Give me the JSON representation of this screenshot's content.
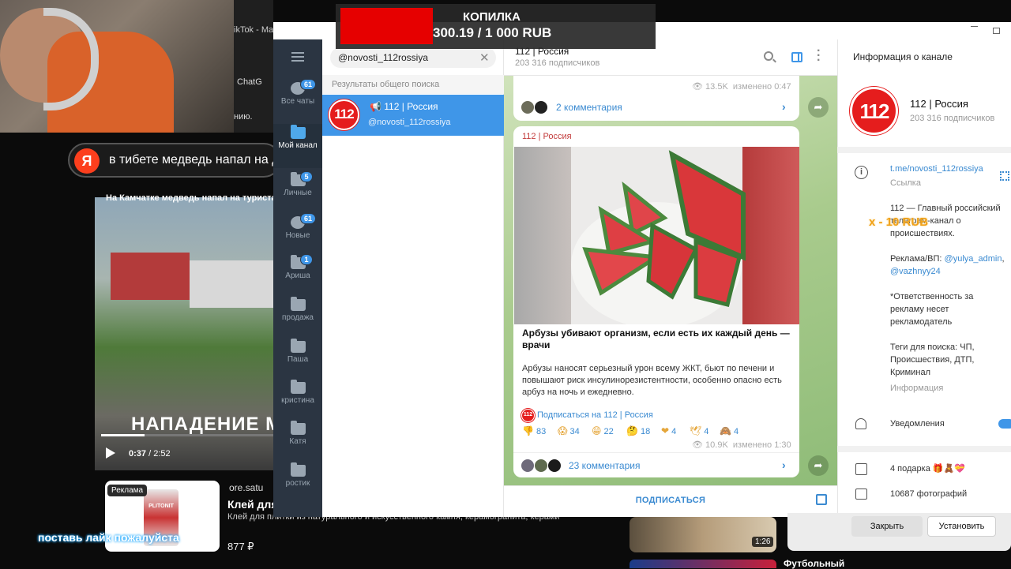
{
  "donation": {
    "title": "КОПИЛКА",
    "amount": "300.19 / 1 000 RUB"
  },
  "bg_browser": {
    "tab": "ikTok - Mak",
    "chat_label": "ChatG",
    "partial_text": "нию.",
    "yandex_logo": "Я",
    "yandex_query": "в тибете медведь напал на де",
    "video_caption_top": "На Камчатке медведь напал на туриста",
    "video_title": "НАПАДЕНИЕ М",
    "video_time_current": "0:37",
    "video_time_total": " / 2:52",
    "video_progress": 0.25,
    "ad_badge": "Реклама",
    "ad_brand": "PLITONIT",
    "ad_source": "ore.satu",
    "ad_title": "Клей для",
    "ad_desc": "Клей для плитки из натурального и искусственного камня, керамогранита, керами",
    "ad_price": "877 ₽",
    "thumb_time": "1:26",
    "right_title": "Футбольный",
    "right_partial": "Д"
  },
  "like_prompt": "поставь лайк пожалуйста",
  "folders": [
    {
      "label": "Все чаты",
      "badge": "61",
      "icon": "chats-bubble-icon"
    },
    {
      "label": "Мой канал",
      "badge": "",
      "icon": "folder-icon",
      "active": true
    },
    {
      "label": "Личные",
      "badge": "5",
      "icon": "folder-icon"
    },
    {
      "label": "Новые",
      "badge": "61",
      "icon": "chats-bubble-icon"
    },
    {
      "label": "Ариша",
      "badge": "1",
      "icon": "folder-icon"
    },
    {
      "label": "продажа",
      "badge": "",
      "icon": "folder-icon"
    },
    {
      "label": "Паша",
      "badge": "",
      "icon": "folder-icon"
    },
    {
      "label": "кристина",
      "badge": "",
      "icon": "folder-icon"
    },
    {
      "label": "Катя",
      "badge": "",
      "icon": "folder-icon"
    },
    {
      "label": "ростик",
      "badge": "",
      "icon": "folder-icon"
    }
  ],
  "search": {
    "query": "@novosti_112rossiya",
    "results_header": "Результаты общего поиска",
    "result": {
      "name": "📢 112 | Россия",
      "handle": "@novosti_112rossiya",
      "avatar_text": "112"
    }
  },
  "chat": {
    "title": "112 | Россия",
    "subscribers": "203 316 подписчиков",
    "top_post": {
      "views": "13.5K",
      "edited": "изменено 0:47",
      "comments": "2 комментария"
    },
    "post": {
      "author": "112 | Россия",
      "title": "Арбузы убивают организм, если есть их каждый день — врачи",
      "body": "Арбузы наносят серьезный урон всему ЖКТ, бьют по печени и повышают риск инсулинорезистентности, особенно опасно есть арбуз на ночь и ежедневно.",
      "subscribe_link": "Подписаться на 112 | Россия",
      "reactions": [
        {
          "emoji": "👎",
          "count": "83"
        },
        {
          "emoji": "😱",
          "count": "34"
        },
        {
          "emoji": "😁",
          "count": "22"
        },
        {
          "emoji": "🤔",
          "count": "18"
        },
        {
          "emoji": "❤",
          "count": "4"
        },
        {
          "emoji": "🕊",
          "count": "4"
        },
        {
          "emoji": "🙈",
          "count": "4"
        }
      ],
      "views": "10.9K",
      "edited": "изменено 1:30",
      "comments": "23 комментария"
    },
    "subscribe_button": "ПОДПИСАТЬСЯ"
  },
  "info": {
    "header": "Информация о канале",
    "name": "112 | Россия",
    "subscribers": "203 316 подписчиков",
    "link": "t.me/novosti_112rossiya",
    "link_label": "Ссылка",
    "desc_1": "112 — Главный российский телеграм-канал о происшествиях.",
    "desc_ad_prefix": "Реклама/ВП: ",
    "desc_ad_user1": "@yulya_admin",
    "desc_ad_sep": ", ",
    "desc_ad_user2": "@vazhnyy24",
    "desc_2": "*Ответственность за рекламу несет рекламодатель",
    "desc_3": "Теги для поиска: ЧП, Происшествия, ДТП, Криминал",
    "desc_label": "Информация",
    "overlay_rub": "x - 10 RUB",
    "notifications": "Уведомления",
    "gifts": "4 подарка 🎁🧸💝",
    "photos": "10687 фотографий"
  },
  "popup": {
    "close": "Закрыть",
    "install": "Установить"
  },
  "colors": {
    "accent": "#3f96e8",
    "brand_red": "#e51d1d",
    "folder_bg": "#2b3542",
    "donation_red": "#e60000"
  }
}
